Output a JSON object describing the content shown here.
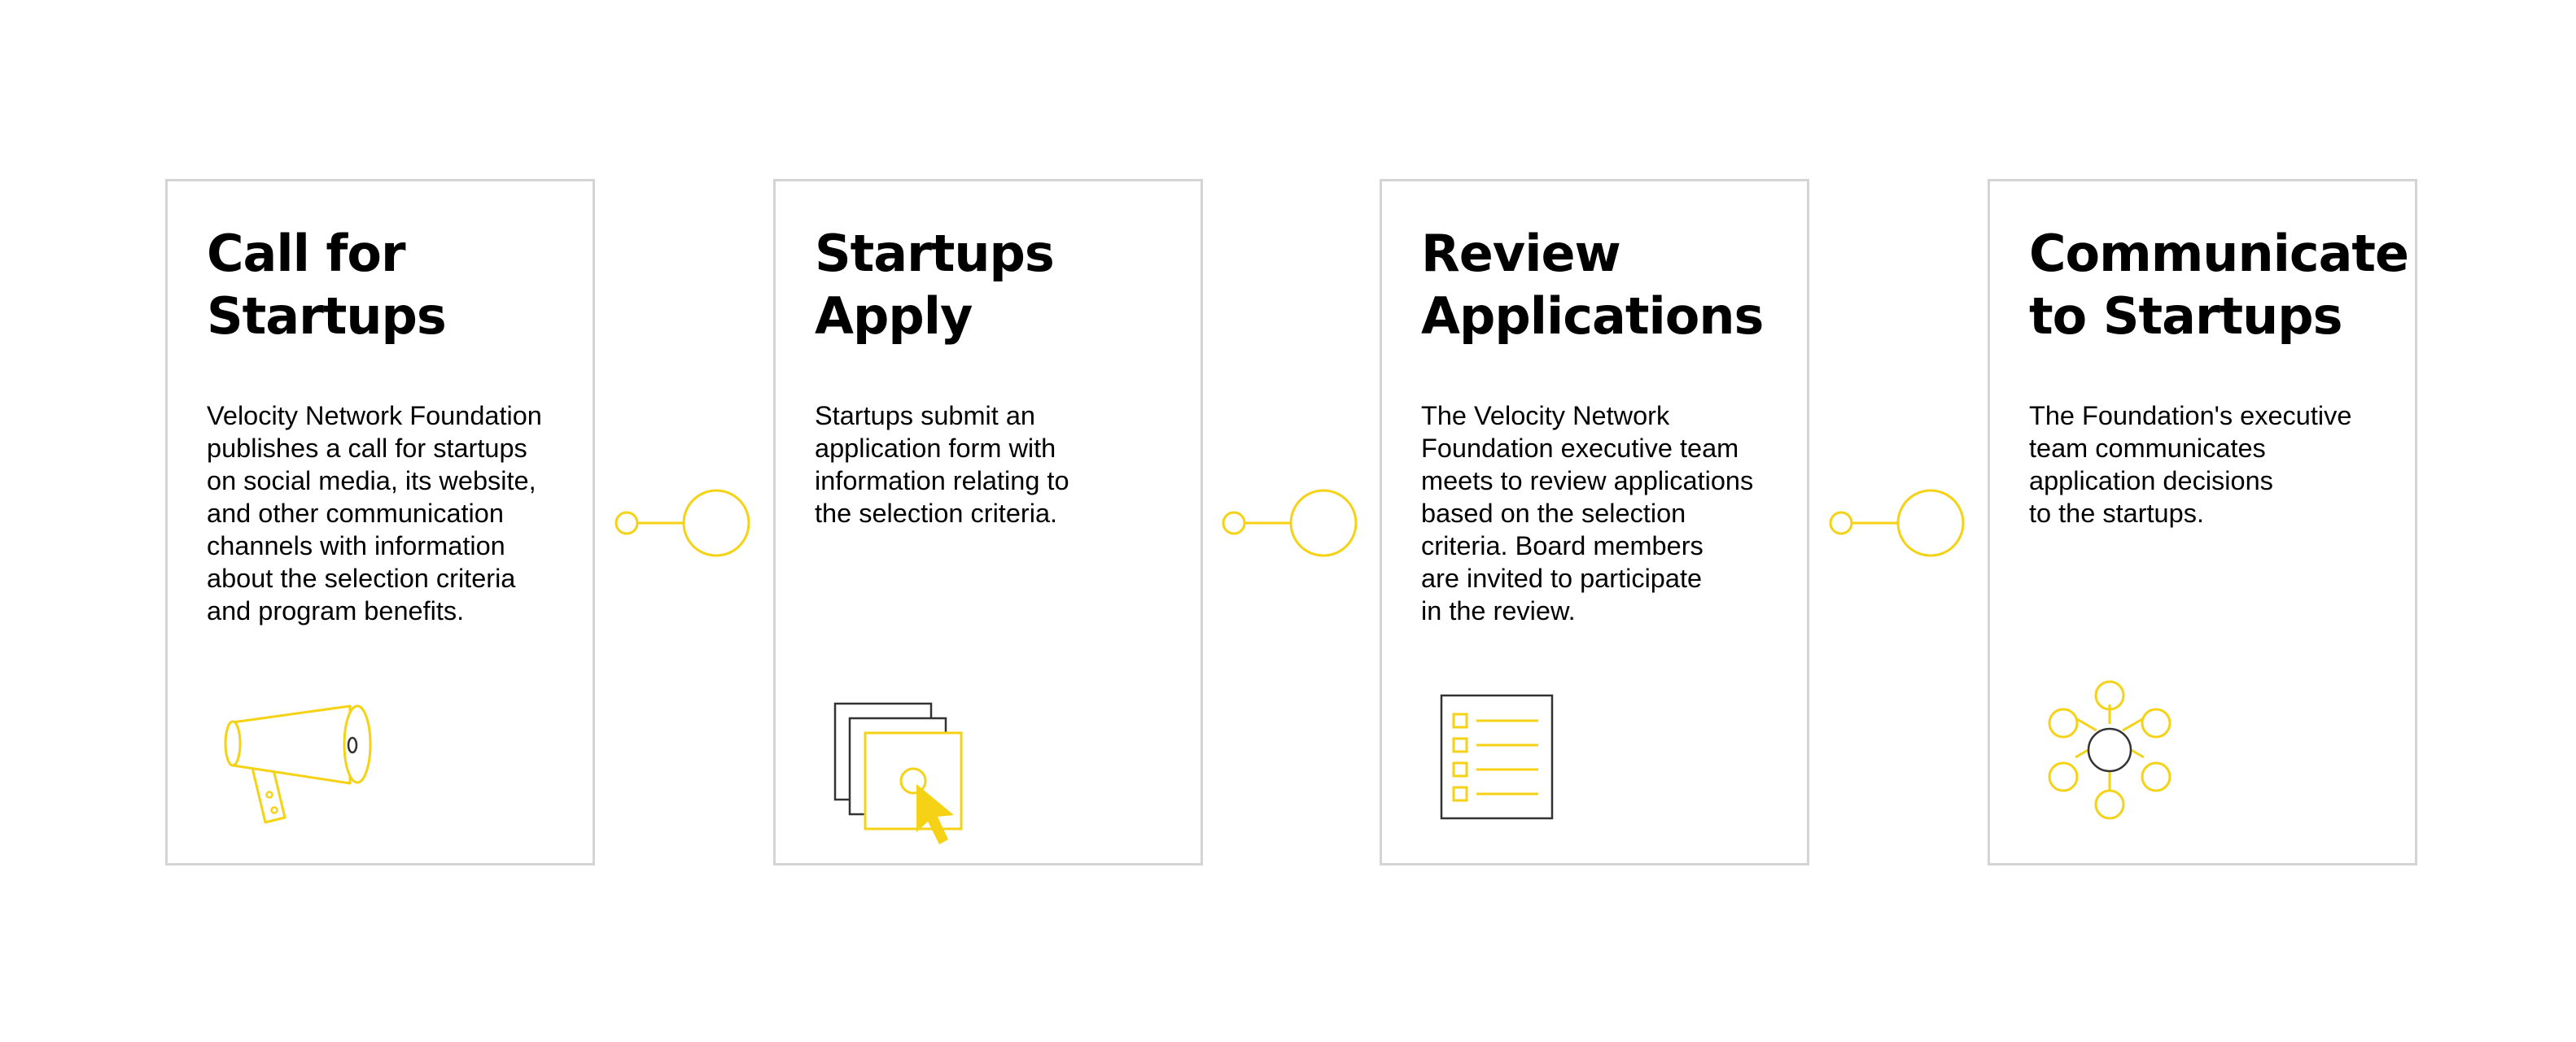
{
  "colors": {
    "accent": "#f5d215",
    "border": "#d4d4d4",
    "text": "#000000",
    "icon_dark": "#333333"
  },
  "steps": [
    {
      "title": "Call for\nStartups",
      "description": "Velocity Network Foundation\npublishes a call for startups\non social media, its website,\nand other communication\nchannels with information\nabout the selection criteria\nand program benefits.",
      "icon": "megaphone-icon"
    },
    {
      "title": "Startups\nApply",
      "description": "Startups submit an\napplication form with\ninformation relating to\nthe selection criteria.",
      "icon": "application-form-click-icon"
    },
    {
      "title": "Review\nApplications",
      "description": "The Velocity Network\nFoundation executive team\nmeets to review applications\nbased on the selection\ncriteria. Board members\nare invited to participate\nin the review.",
      "icon": "checklist-icon"
    },
    {
      "title": "Communicate\nto Startups",
      "description": "The Foundation's executive\nteam communicates\napplication decisions\nto the startups.",
      "icon": "network-hub-icon"
    }
  ],
  "connectors": [
    "connector-icon",
    "connector-icon",
    "connector-icon"
  ]
}
